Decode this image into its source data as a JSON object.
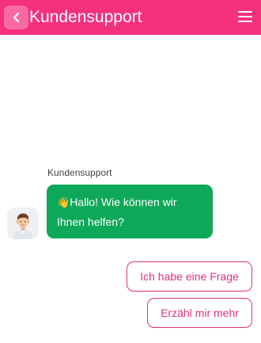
{
  "header": {
    "title": "Kundensupport",
    "background": "#f5317f"
  },
  "chat": {
    "sender_name": "Kundensupport",
    "message_emoji": "👋",
    "message_text": "Hallo! Wie können wir Ihnen helfen?",
    "bubble_color": "#0da85a"
  },
  "quick_replies": [
    {
      "label": "Ich habe eine Frage"
    },
    {
      "label": "Erzähl mir mehr"
    }
  ],
  "accent": "#e4307c"
}
